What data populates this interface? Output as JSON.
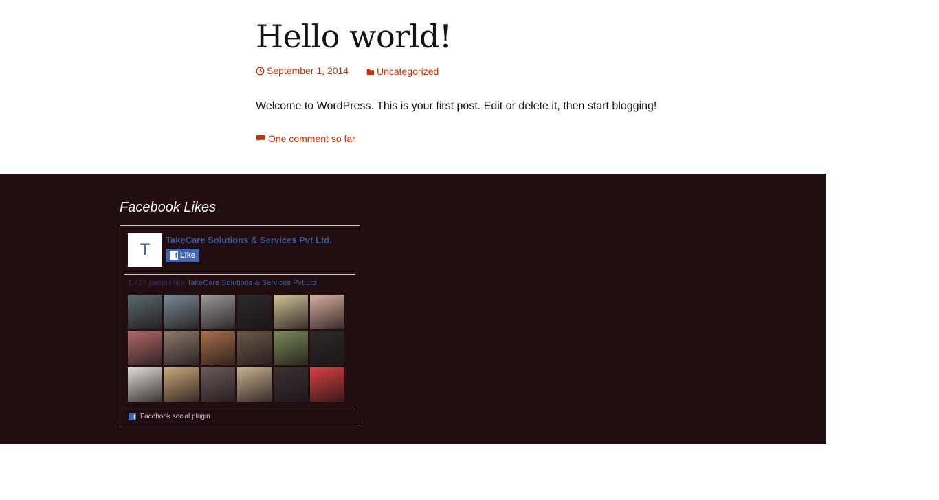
{
  "post": {
    "title": "Hello world!",
    "date": "September 1, 2014",
    "category": "Uncategorized",
    "content": "Welcome to WordPress. This is your first post. Edit or delete it, then start blogging!",
    "comments": "One comment so far"
  },
  "footer": {
    "widget_title": "Facebook Likes",
    "facebook": {
      "logo_letter": "T",
      "page_name": "TakeCare Solutions & Services Pvt Ltd.",
      "like_label": "Like",
      "count_prefix": "1,427 people like",
      "count_page": "TakeCare Solutions & Services Pvt Ltd.",
      "plugin_label": "Facebook social plugin",
      "face_colors": [
        "#5a6a6e",
        "#7a8a96",
        "#9a9a9a",
        "#2a2a2a",
        "#cfc59a",
        "#d8b0a0",
        "#b06a6a",
        "#8a7a6a",
        "#a8704a",
        "#6a5a4a",
        "#7a8a5a",
        "#2a2a2a",
        "#e0dcd8",
        "#c8a878",
        "#6a5a5a",
        "#c8b090",
        "#3a3232",
        "#d84040"
      ]
    }
  },
  "colors": {
    "accent": "#bc360a",
    "footer_bg": "#220e10",
    "fb_blue": "#3b5998"
  }
}
